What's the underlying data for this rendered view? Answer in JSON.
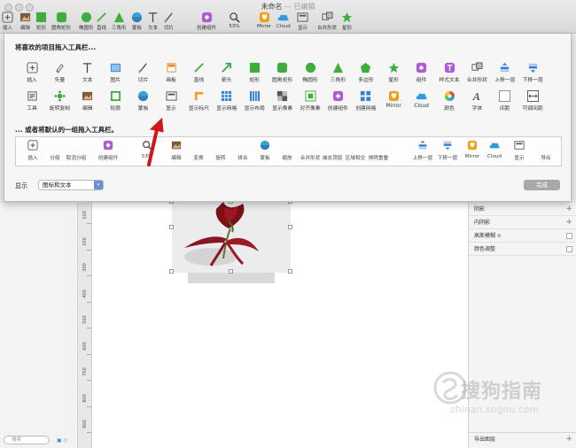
{
  "window": {
    "title": "未命名",
    "title_suffix": "— 已编辑"
  },
  "toolbar": [
    {
      "label": "插入",
      "icon": "plus-icon",
      "color": "#555555"
    },
    {
      "label": "编辑",
      "icon": "edit-image-icon",
      "color": "#7a5c3a"
    },
    {
      "label": "矩形",
      "icon": "rectangle-icon",
      "color": "#3fae3f"
    },
    {
      "label": "圆角矩形",
      "icon": "rounded-rectangle-icon",
      "color": "#3fae3f"
    },
    {
      "label": "椭圆形",
      "icon": "oval-icon",
      "color": "#3fae3f"
    },
    {
      "label": "直线",
      "icon": "line-icon",
      "color": "#3fae3f"
    },
    {
      "label": "三角形",
      "icon": "triangle-icon",
      "color": "#3fae3f"
    },
    {
      "label": "蒙板",
      "icon": "mask-icon",
      "color": "#3aa0d8"
    },
    {
      "label": "文本",
      "icon": "text-icon",
      "color": "#444444"
    },
    {
      "label": "切片",
      "icon": "slice-icon",
      "color": "#555555"
    },
    {
      "label": "创建组件",
      "icon": "symbol-icon",
      "color": "#b05bd6"
    },
    {
      "label": "53%",
      "icon": "zoom-icon",
      "color": "#444444"
    },
    {
      "label": "Mirror",
      "icon": "mirror-icon",
      "color": "#f0a020"
    },
    {
      "label": "Cloud",
      "icon": "cloud-icon",
      "color": "#2e9be0"
    },
    {
      "label": "显示",
      "icon": "view-icon",
      "color": "#555555"
    },
    {
      "label": "合并形状",
      "icon": "combine-icon",
      "color": "#555555"
    },
    {
      "label": "星形",
      "icon": "star-icon",
      "color": "#3fae3f"
    }
  ],
  "sheet": {
    "title": "将喜欢的项目拖入工具栏...",
    "row1": [
      {
        "label": "插入",
        "icon": "plus-icon",
        "color": "#555555"
      },
      {
        "label": "矢量",
        "icon": "vector-pen-icon",
        "color": "#666666"
      },
      {
        "label": "文本",
        "icon": "text-icon",
        "color": "#444444"
      },
      {
        "label": "图片",
        "icon": "image-icon",
        "color": "#3a7fd6"
      },
      {
        "label": "切片",
        "icon": "slice-icon",
        "color": "#555555"
      },
      {
        "label": "画板",
        "icon": "artboard-icon",
        "color": "#f08a2a"
      },
      {
        "label": "直线",
        "icon": "line-icon",
        "color": "#3fae3f"
      },
      {
        "label": "箭头",
        "icon": "arrow-icon",
        "color": "#3fae3f"
      },
      {
        "label": "矩形",
        "icon": "rectangle-icon",
        "color": "#3fae3f"
      },
      {
        "label": "圆角矩形",
        "icon": "rounded-rectangle-icon",
        "color": "#3fae3f"
      },
      {
        "label": "椭圆形",
        "icon": "oval-icon",
        "color": "#3fae3f"
      },
      {
        "label": "三角形",
        "icon": "triangle-icon",
        "color": "#3fae3f"
      },
      {
        "label": "多边形",
        "icon": "polygon-icon",
        "color": "#3fae3f"
      },
      {
        "label": "星形",
        "icon": "star-icon",
        "color": "#3fae3f"
      },
      {
        "label": "组件",
        "icon": "symbol-icon",
        "color": "#b05bd6"
      },
      {
        "label": "样式文本",
        "icon": "text-style-icon",
        "color": "#b05bd6"
      },
      {
        "label": "合并形状",
        "icon": "combine-icon",
        "color": "#555555"
      },
      {
        "label": "上移一层",
        "icon": "move-up-icon",
        "color": "#3a7fd6"
      },
      {
        "label": "下移一层",
        "icon": "move-down-icon",
        "color": "#3a7fd6"
      }
    ],
    "row2": [
      {
        "label": "工具",
        "icon": "tools-icon",
        "color": "#555555"
      },
      {
        "label": "旋转复制",
        "icon": "rotate-copies-icon",
        "color": "#3fae3f"
      },
      {
        "label": "编辑",
        "icon": "edit-image-icon",
        "color": "#7a5c3a"
      },
      {
        "label": "轮廓",
        "icon": "outline-icon",
        "color": "#3fae3f"
      },
      {
        "label": "蒙板",
        "icon": "mask-icon",
        "color": "#3aa0d8"
      },
      {
        "label": "显示",
        "icon": "view-icon",
        "color": "#555555"
      },
      {
        "label": "显示标尺",
        "icon": "ruler-icon",
        "color": "#f0a020"
      },
      {
        "label": "显示网格",
        "icon": "grid-icon",
        "color": "#3a7fd6"
      },
      {
        "label": "显示布局",
        "icon": "layout-icon",
        "color": "#3a7fd6"
      },
      {
        "label": "显示像素",
        "icon": "pixel-icon",
        "color": "#555555"
      },
      {
        "label": "对齐像素",
        "icon": "align-pixel-icon",
        "color": "#3fae3f"
      },
      {
        "label": "创建组件",
        "icon": "symbol-icon",
        "color": "#b05bd6"
      },
      {
        "label": "创建网格",
        "icon": "make-grid-icon",
        "color": "#3a7fd6"
      },
      {
        "label": "Mirror",
        "icon": "mirror-icon",
        "color": "#f0a020"
      },
      {
        "label": "Cloud",
        "icon": "cloud-icon",
        "color": "#2e9be0"
      },
      {
        "label": "颜色",
        "icon": "color-wheel-icon",
        "color": "#e0505a"
      },
      {
        "label": "字体",
        "icon": "font-icon",
        "color": "#333333"
      },
      {
        "label": "间距",
        "icon": "space-icon",
        "color": "#888888"
      },
      {
        "label": "可调间距",
        "icon": "flexible-space-icon",
        "color": "#555555"
      }
    ],
    "default_title": "... 或者将默认的一组拖入工具栏。",
    "default_set": [
      {
        "label": "插入",
        "icon": "plus-icon",
        "color": "#555555"
      },
      {
        "label": "分组",
        "icon": "",
        "color": "#555555"
      },
      {
        "label": "取消分组",
        "icon": "",
        "color": "#555555"
      },
      {
        "label": "创建组件",
        "icon": "symbol-icon",
        "color": "#b05bd6"
      },
      {
        "label": "53%",
        "icon": "zoom-icon",
        "color": "#444444"
      },
      {
        "label": "编辑",
        "icon": "edit-image-icon",
        "color": "#7a5c3a"
      },
      {
        "label": "变换",
        "icon": "",
        "color": "#555555"
      },
      {
        "label": "旋转",
        "icon": "",
        "color": "#555555"
      },
      {
        "label": "拼合",
        "icon": "",
        "color": "#555555"
      },
      {
        "label": "蒙板",
        "icon": "mask-icon",
        "color": "#3aa0d8"
      },
      {
        "label": "缩放",
        "icon": "",
        "color": "#555555"
      },
      {
        "label": "合并形状",
        "icon": "",
        "color": "#555555"
      },
      {
        "label": "减去顶层",
        "icon": "",
        "color": "#555555"
      },
      {
        "label": "区域相交",
        "icon": "",
        "color": "#555555"
      },
      {
        "label": "排除重叠",
        "icon": "",
        "color": "#555555"
      },
      {
        "label": "上移一层",
        "icon": "move-up-icon",
        "color": "#3a7fd6"
      },
      {
        "label": "下移一层",
        "icon": "move-down-icon",
        "color": "#3a7fd6"
      },
      {
        "label": "Mirror",
        "icon": "mirror-icon",
        "color": "#f0a020"
      },
      {
        "label": "Cloud",
        "icon": "cloud-icon",
        "color": "#2e9be0"
      },
      {
        "label": "显示",
        "icon": "view-icon",
        "color": "#555555"
      },
      {
        "label": "导出",
        "icon": "",
        "color": "#555555"
      }
    ],
    "show_label": "显示",
    "show_value": "图标和文本",
    "done_label": "完成"
  },
  "left_panel": {
    "search_placeholder": "搜索"
  },
  "ruler_ticks": [
    "100",
    "200",
    "300",
    "400",
    "500",
    "600",
    "700",
    "800",
    "900"
  ],
  "right_panel": {
    "rows": [
      {
        "label": "阴影",
        "control": "plus"
      },
      {
        "label": "内阴影",
        "control": "plus"
      },
      {
        "label": "高斯模糊 ≎",
        "control": "check"
      },
      {
        "label": "颜色调整",
        "control": "check"
      }
    ],
    "export_label": "导出图层"
  },
  "watermark": {
    "text": "搜狗指南",
    "url": "zhinan.sogou.com"
  }
}
